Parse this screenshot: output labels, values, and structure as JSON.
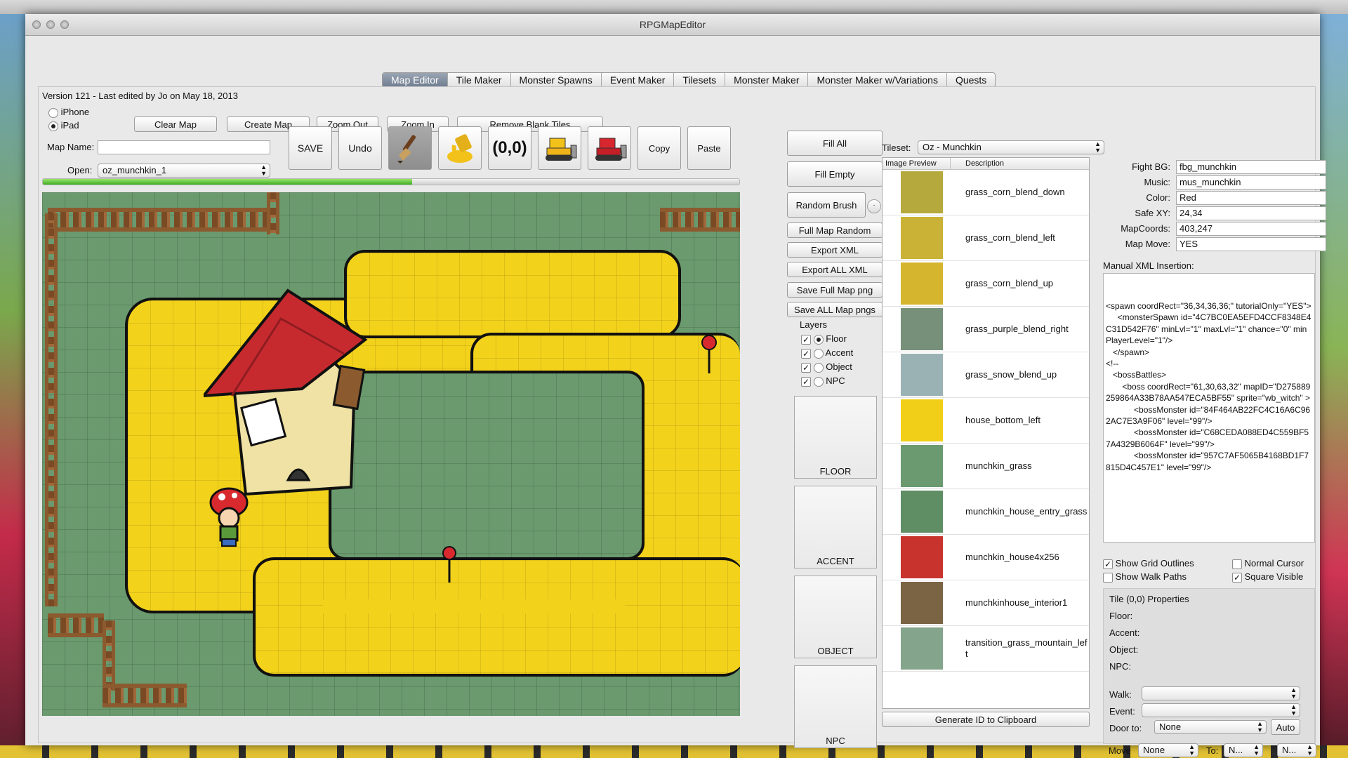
{
  "window": {
    "title": "RPGMapEditor"
  },
  "tabs": [
    "Map Editor",
    "Tile Maker",
    "Monster Spawns",
    "Event Maker",
    "Tilesets",
    "Monster Maker",
    "Monster Maker w/Variations",
    "Quests"
  ],
  "version_text": "Version 121 - Last edited by Jo on May 18, 2013",
  "device": {
    "iphone": "iPhone",
    "ipad": "iPad",
    "selected": "iPad"
  },
  "map_buttons": {
    "clear": "Clear Map",
    "create": "Create Map",
    "zoom_out": "Zoom Out",
    "zoom_in": "Zoom In",
    "remove_blank": "Remove Blank Tiles"
  },
  "map_name": {
    "label": "Map Name:",
    "value": ""
  },
  "open": {
    "label": "Open:",
    "value": "oz_munchkin_1"
  },
  "toolbar": {
    "save": "SAVE",
    "undo": "Undo",
    "coords": "(0,0)",
    "copy": "Copy",
    "paste": "Paste"
  },
  "toolbar_icons": [
    "paintbrush-icon",
    "paint-bucket-icon",
    "yellow-bulldozer-icon",
    "red-bulldozer-icon"
  ],
  "progress": 0.53,
  "fill": {
    "fill_all": "Fill All",
    "fill_empty": "Fill Empty",
    "random_brush": "Random Brush"
  },
  "actions": [
    "Full Map Random",
    "Export XML",
    "Export ALL XML",
    "Save Full Map png",
    "Save ALL Map pngs"
  ],
  "layers": {
    "title": "Layers",
    "items": [
      {
        "name": "Floor",
        "checked": true,
        "selected": true
      },
      {
        "name": "Accent",
        "checked": true,
        "selected": false
      },
      {
        "name": "Object",
        "checked": true,
        "selected": false
      },
      {
        "name": "NPC",
        "checked": true,
        "selected": false
      }
    ],
    "boxes": [
      "FLOOR",
      "ACCENT",
      "OBJECT",
      "NPC"
    ]
  },
  "tileset": {
    "label": "Tileset:",
    "value": "Oz - Munchkin",
    "columns": [
      "Image Preview",
      "Description"
    ],
    "tiles": [
      {
        "name": "grass_corn_blend_down",
        "color": "#b5a83c"
      },
      {
        "name": "grass_corn_blend_left",
        "color": "#c9b236"
      },
      {
        "name": "grass_corn_blend_up",
        "color": "#d6b52e"
      },
      {
        "name": "grass_purple_blend_right",
        "color": "#76907a"
      },
      {
        "name": "grass_snow_blend_up",
        "color": "#9ab2b4"
      },
      {
        "name": "house_bottom_left",
        "color": "#f1cf18"
      },
      {
        "name": "munchkin_grass",
        "color": "#6b9a70"
      },
      {
        "name": "munchkin_house_entry_grass",
        "color": "#5f8d64"
      },
      {
        "name": "munchkin_house4x256",
        "color": "#c8332e"
      },
      {
        "name": "munchkinhouse_interior1",
        "color": "#7a6444"
      },
      {
        "name": "transition_grass_mountain_left",
        "color": "#84a48c"
      }
    ],
    "generate_id": "Generate ID to Clipboard"
  },
  "props": {
    "fight_bg": {
      "label": "Fight BG:",
      "value": "fbg_munchkin"
    },
    "music": {
      "label": "Music:",
      "value": "mus_munchkin"
    },
    "color": {
      "label": "Color:",
      "value": "Red"
    },
    "safe_xy": {
      "label": "Safe XY:",
      "value": "24,34"
    },
    "map_coords": {
      "label": "MapCoords:",
      "value": "403,247"
    },
    "map_move": {
      "label": "Map Move:",
      "value": "YES"
    }
  },
  "xml": {
    "label": "Manual XML Insertion:",
    "text": "<spawn coordRect=\"36,34,36,36;\" tutorialOnly=\"YES\">\n     <monsterSpawn id=\"4C7BC0EA5EFD4CCF8348E4C31D542F76\" minLvl=\"1\" maxLvl=\"1\" chance=\"0\" minPlayerLevel=\"1\"/>\n   </spawn>\n<!--\n   <bossBattles>\n       <boss coordRect=\"61,30,63,32\" mapID=\"D275889259864A33B78AA547ECA5BF55\" sprite=\"wb_witch\" >\n            <bossMonster id=\"84F464AB22FC4C16A6C962AC7E3A9F06\" level=\"99\"/>\n            <bossMonster id=\"C68CEDA088ED4C559BF57A4329B6064F\" level=\"99\"/>\n            <bossMonster id=\"957C7AF5065B4168BD1F7815D4C457E1\" level=\"99\"/>"
  },
  "options": {
    "show_grid": {
      "label": "Show Grid Outlines",
      "checked": true
    },
    "normal_cursor": {
      "label": "Normal Cursor",
      "checked": false
    },
    "show_walk": {
      "label": "Show Walk Paths",
      "checked": false
    },
    "square_visible": {
      "label": "Square Visible",
      "checked": true
    }
  },
  "tile_props": {
    "title": "Tile (0,0) Properties",
    "floor": "Floor:",
    "accent": "Accent:",
    "object": "Object:",
    "npc": "NPC:",
    "walk": "Walk:",
    "event": "Event:",
    "door_label": "Door to:",
    "door_value": "None",
    "auto": "Auto",
    "move_label": "Move",
    "move_value": "None",
    "to_label": "To:",
    "to_a": "N...",
    "to_b": "N..."
  }
}
